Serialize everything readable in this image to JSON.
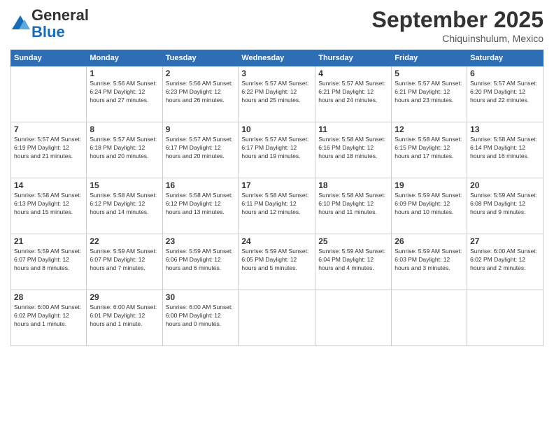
{
  "logo": {
    "general": "General",
    "blue": "Blue"
  },
  "header": {
    "month": "September 2025",
    "location": "Chiquinshulum, Mexico"
  },
  "days_of_week": [
    "Sunday",
    "Monday",
    "Tuesday",
    "Wednesday",
    "Thursday",
    "Friday",
    "Saturday"
  ],
  "weeks": [
    [
      {
        "day": "",
        "info": ""
      },
      {
        "day": "1",
        "info": "Sunrise: 5:56 AM\nSunset: 6:24 PM\nDaylight: 12 hours\nand 27 minutes."
      },
      {
        "day": "2",
        "info": "Sunrise: 5:56 AM\nSunset: 6:23 PM\nDaylight: 12 hours\nand 26 minutes."
      },
      {
        "day": "3",
        "info": "Sunrise: 5:57 AM\nSunset: 6:22 PM\nDaylight: 12 hours\nand 25 minutes."
      },
      {
        "day": "4",
        "info": "Sunrise: 5:57 AM\nSunset: 6:21 PM\nDaylight: 12 hours\nand 24 minutes."
      },
      {
        "day": "5",
        "info": "Sunrise: 5:57 AM\nSunset: 6:21 PM\nDaylight: 12 hours\nand 23 minutes."
      },
      {
        "day": "6",
        "info": "Sunrise: 5:57 AM\nSunset: 6:20 PM\nDaylight: 12 hours\nand 22 minutes."
      }
    ],
    [
      {
        "day": "7",
        "info": "Sunrise: 5:57 AM\nSunset: 6:19 PM\nDaylight: 12 hours\nand 21 minutes."
      },
      {
        "day": "8",
        "info": "Sunrise: 5:57 AM\nSunset: 6:18 PM\nDaylight: 12 hours\nand 20 minutes."
      },
      {
        "day": "9",
        "info": "Sunrise: 5:57 AM\nSunset: 6:17 PM\nDaylight: 12 hours\nand 20 minutes."
      },
      {
        "day": "10",
        "info": "Sunrise: 5:57 AM\nSunset: 6:17 PM\nDaylight: 12 hours\nand 19 minutes."
      },
      {
        "day": "11",
        "info": "Sunrise: 5:58 AM\nSunset: 6:16 PM\nDaylight: 12 hours\nand 18 minutes."
      },
      {
        "day": "12",
        "info": "Sunrise: 5:58 AM\nSunset: 6:15 PM\nDaylight: 12 hours\nand 17 minutes."
      },
      {
        "day": "13",
        "info": "Sunrise: 5:58 AM\nSunset: 6:14 PM\nDaylight: 12 hours\nand 16 minutes."
      }
    ],
    [
      {
        "day": "14",
        "info": "Sunrise: 5:58 AM\nSunset: 6:13 PM\nDaylight: 12 hours\nand 15 minutes."
      },
      {
        "day": "15",
        "info": "Sunrise: 5:58 AM\nSunset: 6:12 PM\nDaylight: 12 hours\nand 14 minutes."
      },
      {
        "day": "16",
        "info": "Sunrise: 5:58 AM\nSunset: 6:12 PM\nDaylight: 12 hours\nand 13 minutes."
      },
      {
        "day": "17",
        "info": "Sunrise: 5:58 AM\nSunset: 6:11 PM\nDaylight: 12 hours\nand 12 minutes."
      },
      {
        "day": "18",
        "info": "Sunrise: 5:58 AM\nSunset: 6:10 PM\nDaylight: 12 hours\nand 11 minutes."
      },
      {
        "day": "19",
        "info": "Sunrise: 5:59 AM\nSunset: 6:09 PM\nDaylight: 12 hours\nand 10 minutes."
      },
      {
        "day": "20",
        "info": "Sunrise: 5:59 AM\nSunset: 6:08 PM\nDaylight: 12 hours\nand 9 minutes."
      }
    ],
    [
      {
        "day": "21",
        "info": "Sunrise: 5:59 AM\nSunset: 6:07 PM\nDaylight: 12 hours\nand 8 minutes."
      },
      {
        "day": "22",
        "info": "Sunrise: 5:59 AM\nSunset: 6:07 PM\nDaylight: 12 hours\nand 7 minutes."
      },
      {
        "day": "23",
        "info": "Sunrise: 5:59 AM\nSunset: 6:06 PM\nDaylight: 12 hours\nand 6 minutes."
      },
      {
        "day": "24",
        "info": "Sunrise: 5:59 AM\nSunset: 6:05 PM\nDaylight: 12 hours\nand 5 minutes."
      },
      {
        "day": "25",
        "info": "Sunrise: 5:59 AM\nSunset: 6:04 PM\nDaylight: 12 hours\nand 4 minutes."
      },
      {
        "day": "26",
        "info": "Sunrise: 5:59 AM\nSunset: 6:03 PM\nDaylight: 12 hours\nand 3 minutes."
      },
      {
        "day": "27",
        "info": "Sunrise: 6:00 AM\nSunset: 6:02 PM\nDaylight: 12 hours\nand 2 minutes."
      }
    ],
    [
      {
        "day": "28",
        "info": "Sunrise: 6:00 AM\nSunset: 6:02 PM\nDaylight: 12 hours\nand 1 minute."
      },
      {
        "day": "29",
        "info": "Sunrise: 6:00 AM\nSunset: 6:01 PM\nDaylight: 12 hours\nand 1 minute."
      },
      {
        "day": "30",
        "info": "Sunrise: 6:00 AM\nSunset: 6:00 PM\nDaylight: 12 hours\nand 0 minutes."
      },
      {
        "day": "",
        "info": ""
      },
      {
        "day": "",
        "info": ""
      },
      {
        "day": "",
        "info": ""
      },
      {
        "day": "",
        "info": ""
      }
    ]
  ]
}
